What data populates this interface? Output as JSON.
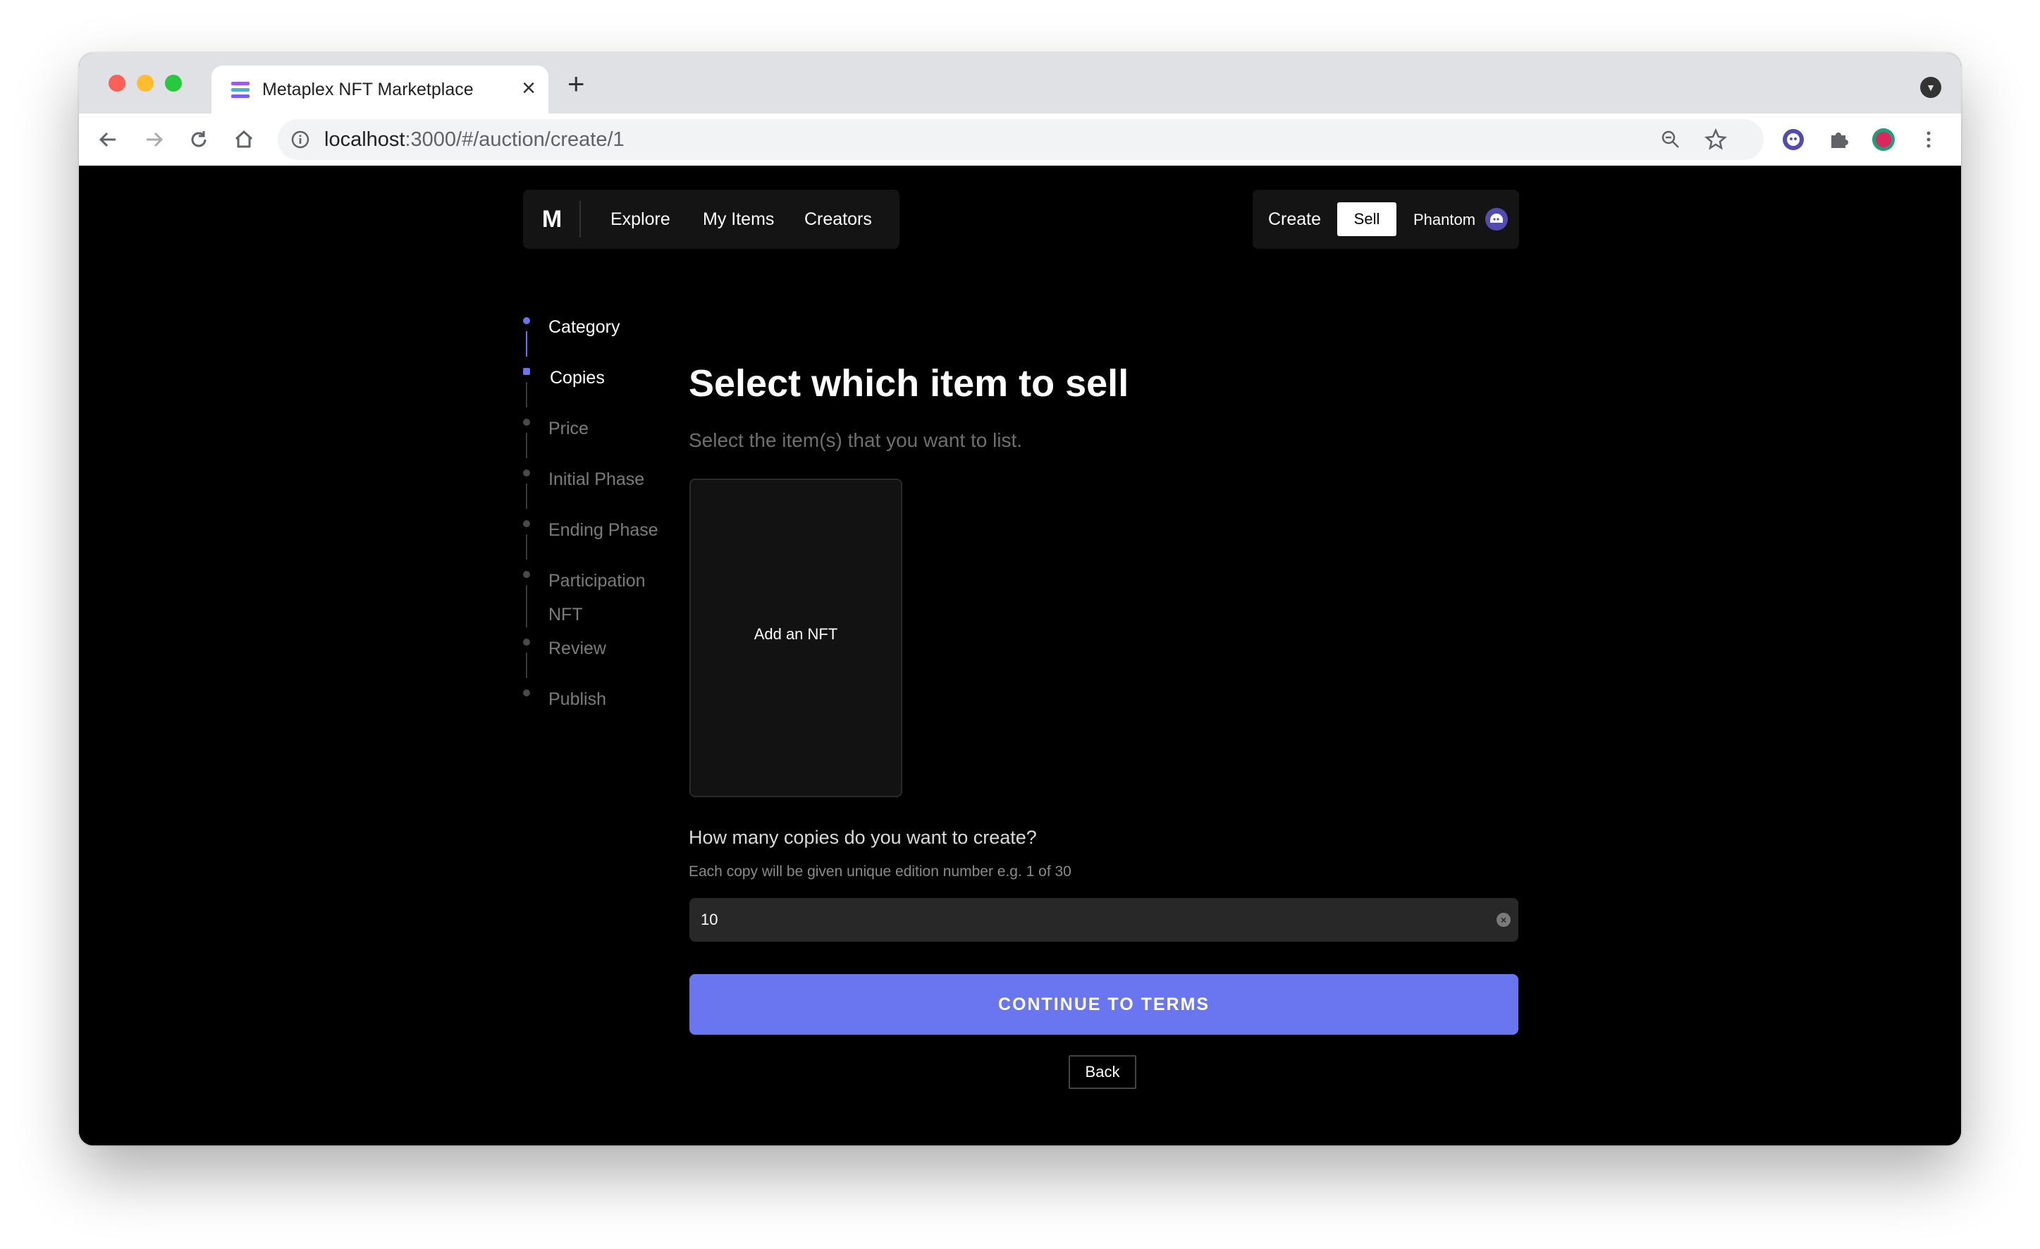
{
  "browser": {
    "tab_title": "Metaplex NFT Marketplace",
    "tab_close": "×",
    "new_tab": "+",
    "url_host": "localhost",
    "url_path": ":3000/#/auction/create/1"
  },
  "nav": {
    "logo": "M",
    "links": [
      "Explore",
      "My Items",
      "Creators"
    ],
    "create": "Create",
    "sell": "Sell",
    "wallet": "Phantom"
  },
  "steps": [
    {
      "label": "Category",
      "state": "done"
    },
    {
      "label": "Copies",
      "state": "current"
    },
    {
      "label": "Price",
      "state": "pending"
    },
    {
      "label": "Initial Phase",
      "state": "pending"
    },
    {
      "label": "Ending Phase",
      "state": "pending"
    },
    {
      "label": "Participation NFT",
      "state": "pending"
    },
    {
      "label": "Review",
      "state": "pending"
    },
    {
      "label": "Publish",
      "state": "pending"
    }
  ],
  "main": {
    "title": "Select which item to sell",
    "subtitle": "Select the item(s) that you want to list.",
    "add_nft": "Add an NFT",
    "copies_question": "How many copies do you want to create?",
    "copies_hint": "Each copy will be given unique edition number e.g. 1 of 30",
    "copies_value": "10",
    "continue": "CONTINUE TO TERMS",
    "back": "Back"
  },
  "colors": {
    "accent": "#6976f0",
    "background": "#000000",
    "panel": "#141414"
  }
}
